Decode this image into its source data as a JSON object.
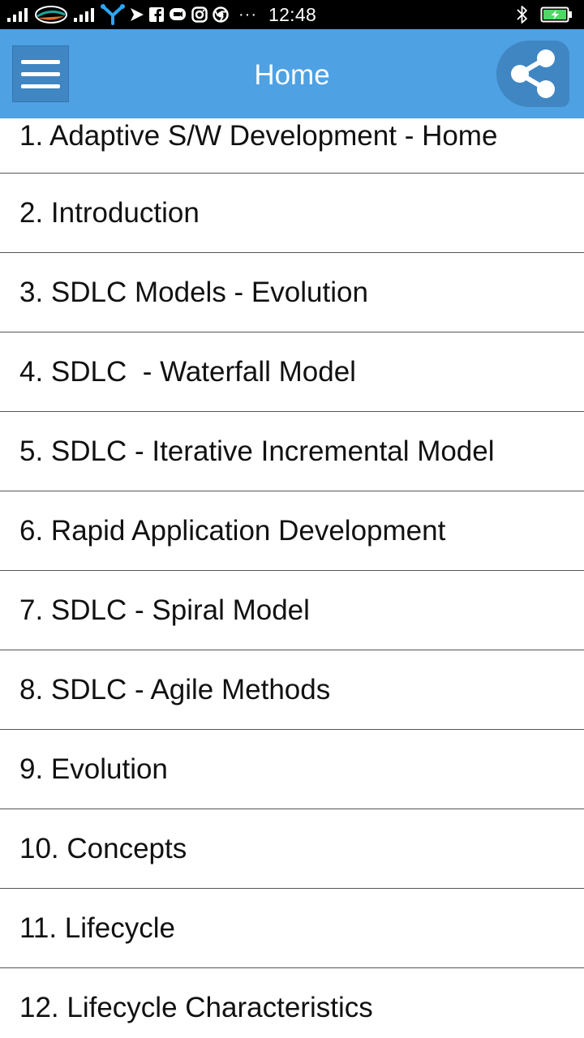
{
  "status_bar": {
    "time": "12:48",
    "overflow_indicator": "···",
    "icons": [
      "signal-icon",
      "carrier-logo",
      "signal-icon",
      "tree-icon",
      "send-icon",
      "facebook-icon",
      "messenger-icon",
      "instagram-icon",
      "chrome-icon",
      "bluetooth-icon",
      "battery-charging-icon"
    ],
    "battery_color": "#4cd964"
  },
  "toolbar": {
    "title": "Home",
    "menu_icon": "hamburger-menu-icon",
    "share_icon": "share-icon",
    "background": "#4ea1e2"
  },
  "list": {
    "items": [
      {
        "label": "1. Adaptive S/W Development - Home"
      },
      {
        "label": "2. Introduction"
      },
      {
        "label": "3. SDLC Models - Evolution"
      },
      {
        "label": "4. SDLC  - Waterfall Model"
      },
      {
        "label": "5. SDLC - Iterative Incremental Model"
      },
      {
        "label": "6. Rapid Application Development"
      },
      {
        "label": "7. SDLC - Spiral Model"
      },
      {
        "label": "8. SDLC - Agile Methods"
      },
      {
        "label": "9. Evolution"
      },
      {
        "label": "10. Concepts"
      },
      {
        "label": "11. Lifecycle"
      },
      {
        "label": "12. Lifecycle Characteristics"
      }
    ]
  }
}
